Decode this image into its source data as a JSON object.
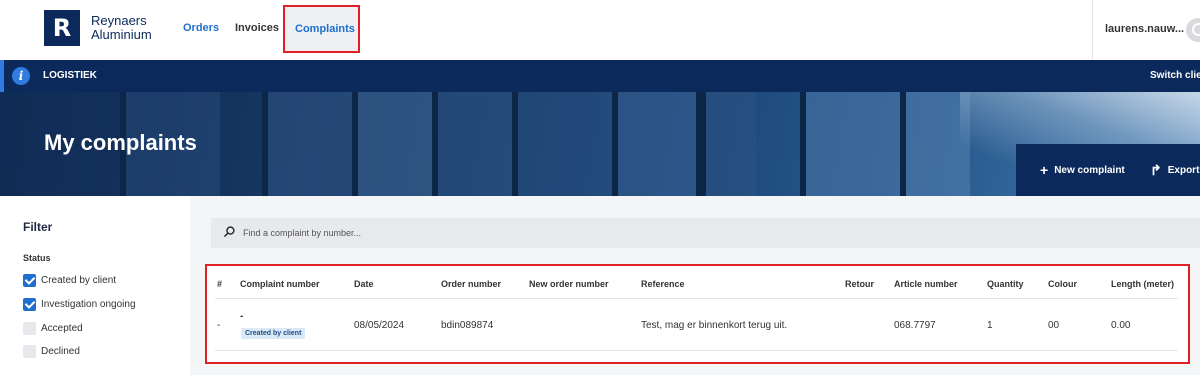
{
  "brand": {
    "line1": "Reynaers",
    "line2": "Aluminium",
    "logo_letter": "R"
  },
  "nav": {
    "orders": "Orders",
    "invoices": "Invoices",
    "complaints": "Complaints",
    "active": "complaints"
  },
  "user": {
    "name": "laurens.nauw..."
  },
  "clientbar": {
    "client_name": "LOGISTIEK",
    "switch_label": "Switch clie",
    "info_icon": "info-icon"
  },
  "hero": {
    "title": "My complaints",
    "new_complaint": "New complaint",
    "export": "Export"
  },
  "filter": {
    "title": "Filter",
    "status_label": "Status",
    "options": [
      {
        "label": "Created by client",
        "checked": true
      },
      {
        "label": "Investigation ongoing",
        "checked": true
      },
      {
        "label": "Accepted",
        "checked": false
      },
      {
        "label": "Declined",
        "checked": false
      }
    ]
  },
  "search": {
    "placeholder": "Find a complaint by number..."
  },
  "table": {
    "headers": [
      "#",
      "Complaint number",
      "Date",
      "Order number",
      "New order number",
      "Reference",
      "Retour",
      "Article number",
      "Quantity",
      "Colour",
      "Length (meter)"
    ],
    "rows": [
      {
        "index": "-",
        "complaint_number": "-",
        "status_badge": "Created by client",
        "date": "08/05/2024",
        "order_number": "bdin089874",
        "new_order_number": "",
        "reference": "Test, mag er binnenkort terug uit.",
        "retour": "",
        "article_number": "068.7797",
        "quantity": "1",
        "colour": "00",
        "length": "0.00"
      }
    ]
  },
  "colors": {
    "navy": "#0b2a5b",
    "link_blue": "#1e6fd0",
    "highlight_red": "#e01f26"
  }
}
